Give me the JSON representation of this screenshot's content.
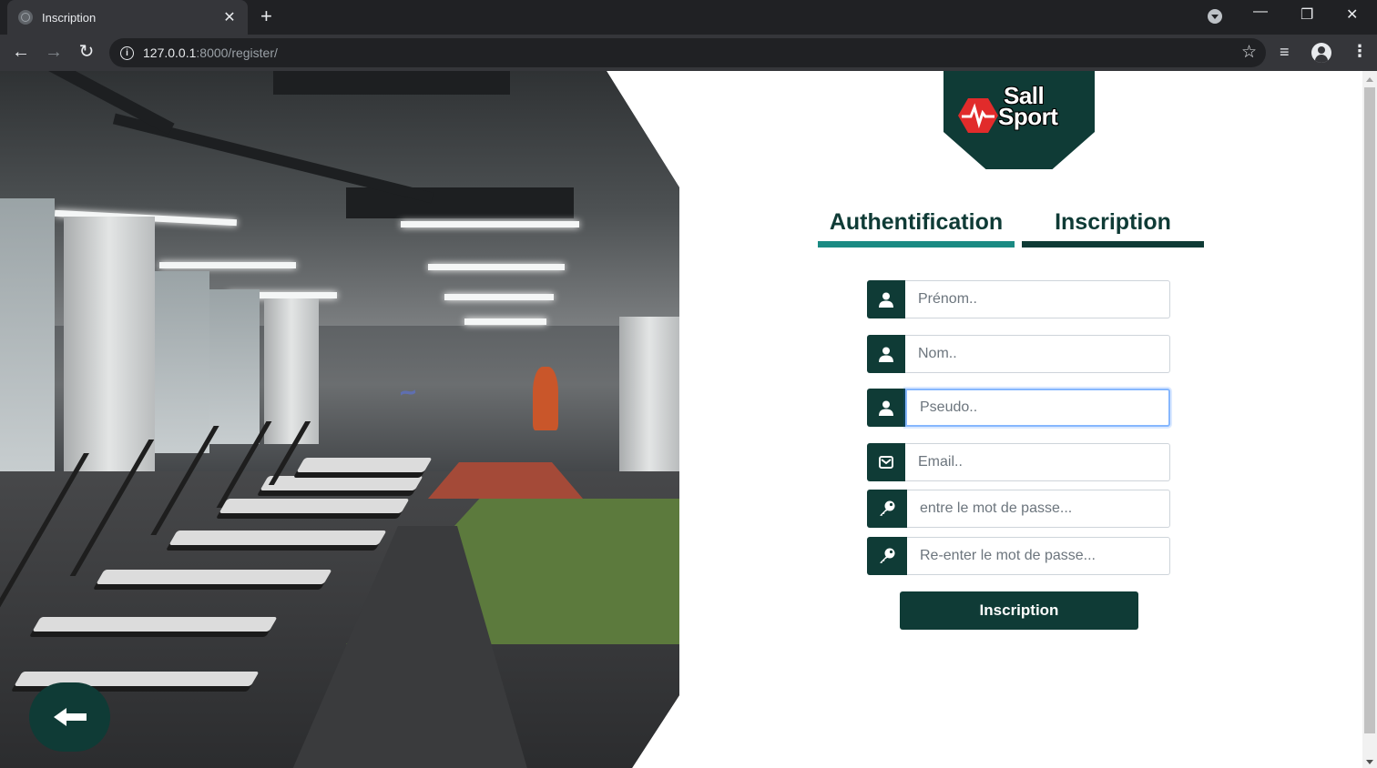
{
  "browser": {
    "tab_title": "Inscription",
    "tab_close": "✕",
    "new_tab": "+",
    "url_host": "127.0.0.1",
    "url_rest": ":8000/register/",
    "minimize": "—",
    "restore": "❐",
    "close": "✕"
  },
  "logo": {
    "line1": "Sall",
    "line2": "Sport"
  },
  "tabs": [
    {
      "label": "Authentification",
      "underline_color": "#1a8a83",
      "active": false
    },
    {
      "label": "Inscription",
      "underline_color": "#0f3b36",
      "active": true
    }
  ],
  "form": {
    "prenom_placeholder": "Prénom..",
    "nom_placeholder": "Nom..",
    "pseudo_placeholder": "Pseudo..",
    "email_placeholder": "Email..",
    "password_placeholder": "entre le mot de passe...",
    "password_confirm_placeholder": "Re-enter le mot de passe...",
    "submit_label": "Inscription"
  },
  "colors": {
    "brand_dark": "#0f3b36",
    "brand_teal": "#1a8a83",
    "logo_red": "#e12b2b"
  },
  "icons": {
    "user": "user-icon",
    "email": "envelope-icon",
    "password": "key-icon",
    "back": "arrow-left-icon"
  }
}
